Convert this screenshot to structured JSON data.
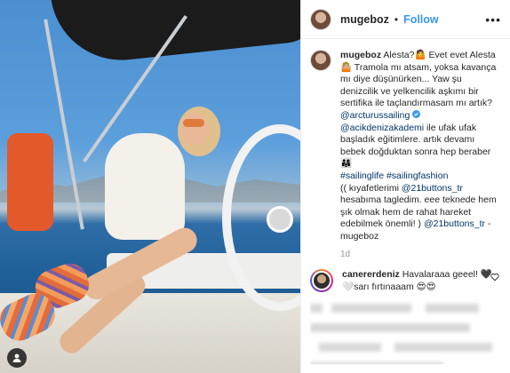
{
  "header": {
    "username": "mugeboz",
    "separator": "•",
    "follow_label": "Follow",
    "more_label": "•••"
  },
  "caption": {
    "username": "mugeboz",
    "line1": " Alesta?🤷 Evet evet Alesta 🤷🏼 Tramola mı atsam, yoksa kavança mı diye düşünürken... Yaw şu denizcilik ve yelkencilik aşkımı bir sertifika ile taçlandırmasam mı artık?",
    "mention1": "@arcturussailing",
    "mention2": "@acikdenizakademi",
    "line2": " ile ufak ufak başladık eğitimlere. artık devamı bebek doğduktan sonra hep beraber 👨‍👩‍👧",
    "hashtags": "#sailinglife #sailingfashion",
    "line3": "(( kıyafetlerimi ",
    "mention3": "@21buttons_tr",
    "line4": " hesabıma tagledim. eee teknede hem şık olmak hem de rahat hareket edebilmek önemli! ) ",
    "mention4": "@21buttons_tr",
    "line5": " - mugeboz"
  },
  "age": "1d",
  "comment": {
    "username": "canererdeniz",
    "text": " Havalaraaa geeel! 🖤🤍sarı fırtınaaam 😍😍"
  },
  "icons": {
    "verified": "verified-badge-icon",
    "heart": "heart-icon",
    "user": "user-tag-icon"
  },
  "colors": {
    "link": "#003569",
    "follow": "#3897f0",
    "muted": "#999999"
  }
}
